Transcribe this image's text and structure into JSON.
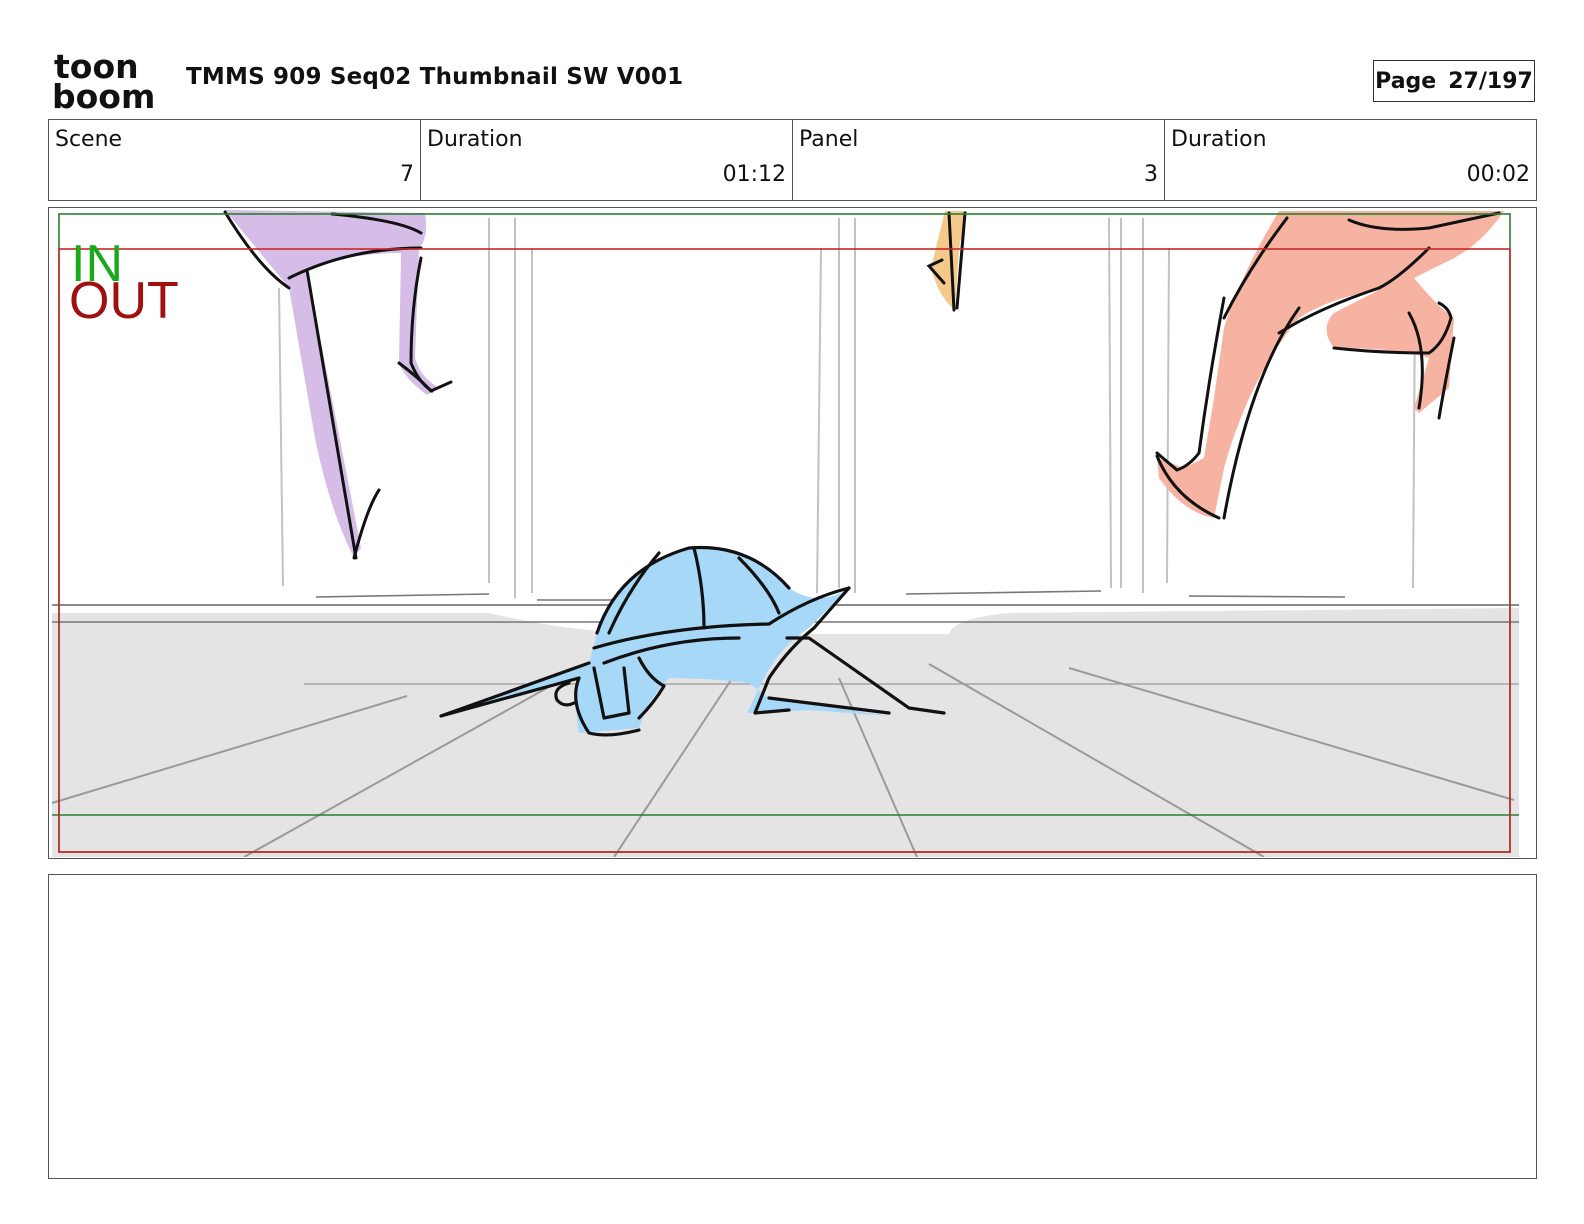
{
  "header": {
    "logo": {
      "line1": "toon",
      "line2": "boom"
    },
    "title": "TMMS 909 Seq02 Thumbnail SW V001",
    "page_label": "Page",
    "page_value": "27/197"
  },
  "info": [
    {
      "label": "Scene",
      "value": "7"
    },
    {
      "label": "Duration",
      "value": "01:12"
    },
    {
      "label": "Panel",
      "value": "3"
    },
    {
      "label": "Duration",
      "value": "00:02"
    }
  ],
  "panel": {
    "in_label": "IN",
    "out_label": "OUT",
    "colors": {
      "in": "#1aa91a",
      "out": "#a01010",
      "in_frame": "#2e7d32",
      "out_frame": "#c62828",
      "floor": "#e4e4e4",
      "character_blue": "#a8d8f8",
      "character_purple": "#d6bde8",
      "character_pink": "#f7b3a2",
      "character_orange": "#f5c98a"
    }
  },
  "notes": {
    "text": ""
  }
}
